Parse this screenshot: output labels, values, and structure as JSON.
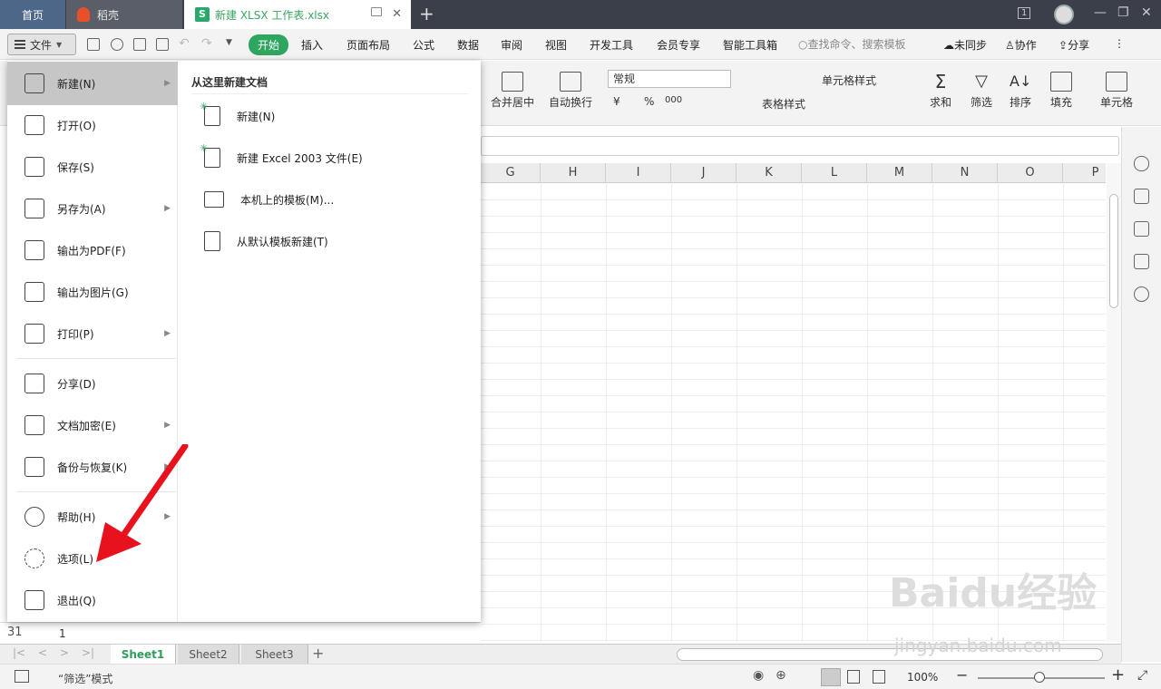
{
  "tabs": {
    "home": "首页",
    "daoke": "稻壳",
    "doc": "新建 XLSX 工作表.xlsx",
    "new_tab_plus": "+"
  },
  "window": {
    "restore_box_label": "1"
  },
  "menubar": {
    "file": "文件",
    "tabs": [
      "开始",
      "插入",
      "页面布局",
      "公式",
      "数据",
      "审阅",
      "视图",
      "开发工具",
      "会员专享",
      "智能工具箱"
    ],
    "search_placeholder": "查找命令、搜索模板",
    "sync": "未同步",
    "collab": "协作",
    "share": "分享"
  },
  "ribbon": {
    "merge": "合并居中",
    "wrap": "自动换行",
    "number_format": "常规",
    "cond_format": "单元格样式",
    "table_style": "表格样式",
    "sum": "求和",
    "filter": "筛选",
    "sort": "排序",
    "fill": "填充",
    "cell": "单元格",
    "currency": "¥",
    "percent": "%",
    "thousands": "000"
  },
  "columns": [
    "G",
    "H",
    "I",
    "J",
    "K",
    "L",
    "M",
    "N",
    "O",
    "P"
  ],
  "row": {
    "number": "31",
    "value": "1"
  },
  "filemenu": {
    "items": [
      {
        "label": "新建(N)",
        "icon": "new-file-icon",
        "has_sub": true
      },
      {
        "label": "打开(O)",
        "icon": "folder-open-icon",
        "has_sub": false
      },
      {
        "label": "保存(S)",
        "icon": "save-icon",
        "has_sub": false
      },
      {
        "label": "另存为(A)",
        "icon": "save-as-icon",
        "has_sub": true
      },
      {
        "label": "输出为PDF(F)",
        "icon": "pdf-icon",
        "has_sub": false
      },
      {
        "label": "输出为图片(G)",
        "icon": "image-icon",
        "has_sub": false
      },
      {
        "label": "打印(P)",
        "icon": "printer-icon",
        "has_sub": true
      },
      {
        "label": "分享(D)",
        "icon": "share-icon",
        "has_sub": false
      },
      {
        "label": "文档加密(E)",
        "icon": "encrypt-icon",
        "has_sub": true
      },
      {
        "label": "备份与恢复(K)",
        "icon": "backup-icon",
        "has_sub": true
      },
      {
        "label": "帮助(H)",
        "icon": "help-icon",
        "has_sub": true
      },
      {
        "label": "选项(L)",
        "icon": "gear-icon",
        "has_sub": false
      },
      {
        "label": "退出(Q)",
        "icon": "exit-icon",
        "has_sub": false
      }
    ],
    "submenu_title": "从这里新建文档",
    "submenu": [
      {
        "label": "新建(N)",
        "icon": "new-doc-icon"
      },
      {
        "label": "新建 Excel 2003 文件(E)",
        "icon": "new-excel2003-icon"
      },
      {
        "label": "本机上的模板(M)...",
        "icon": "local-template-icon"
      },
      {
        "label": "从默认模板新建(T)",
        "icon": "default-template-icon"
      }
    ]
  },
  "sheets": [
    "Sheet1",
    "Sheet2",
    "Sheet3"
  ],
  "status": {
    "mode": "“筛选”模式",
    "zoom": "100%"
  },
  "colors": {
    "accent": "#2ea660",
    "titlebar": "#3b3f4a",
    "home_tab": "#4c6788",
    "arrow": "#e8121e"
  },
  "watermark": {
    "text": "Baidu经验",
    "url": "jingyan.baidu.com"
  }
}
